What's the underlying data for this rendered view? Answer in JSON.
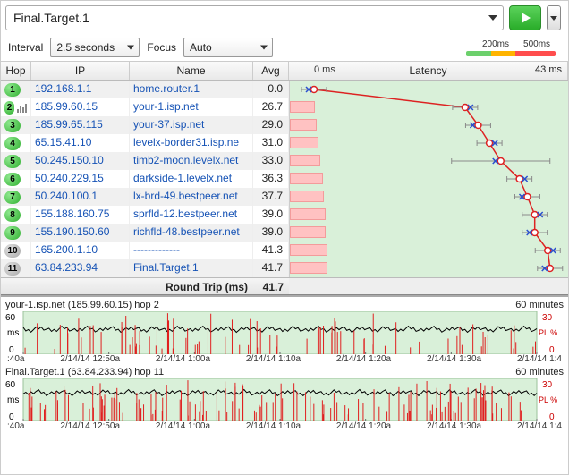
{
  "target": "Final.Target.1",
  "controls": {
    "interval_label": "Interval",
    "interval_value": "2.5 seconds",
    "focus_label": "Focus",
    "focus_value": "Auto",
    "scale_200": "200ms",
    "scale_500": "500ms"
  },
  "columns": {
    "hop": "Hop",
    "ip": "IP",
    "name": "Name",
    "avg": "Avg",
    "latency": "Latency",
    "lat_min": "0 ms",
    "lat_max": "43 ms"
  },
  "footer": {
    "label": "Round Trip (ms)",
    "value": "41.7"
  },
  "hops": [
    {
      "n": "1",
      "ip": "192.168.1.1",
      "name": "home.router.1",
      "avg": "0.0",
      "pink": 0,
      "pt": 0.0,
      "bars": false
    },
    {
      "n": "2",
      "ip": "185.99.60.15",
      "name": "your-1.isp.net",
      "avg": "26.7",
      "pink": 28,
      "pt": 26.7,
      "bars": true
    },
    {
      "n": "3",
      "ip": "185.99.65.115",
      "name": "your-37.isp.net",
      "avg": "29.0",
      "pink": 30,
      "pt": 29.0,
      "bars": false
    },
    {
      "n": "4",
      "ip": "65.15.41.10",
      "name": "levelx-border31.isp.ne",
      "avg": "31.0",
      "pink": 32,
      "pt": 31.0,
      "bars": false
    },
    {
      "n": "5",
      "ip": "50.245.150.10",
      "name": "timb2-moon.levelx.net",
      "avg": "33.0",
      "pink": 34,
      "pt": 33.0,
      "bars": false
    },
    {
      "n": "6",
      "ip": "50.240.229.15",
      "name": "darkside-1.levelx.net",
      "avg": "36.3",
      "pink": 37,
      "pt": 36.3,
      "bars": false
    },
    {
      "n": "7",
      "ip": "50.240.100.1",
      "name": "lx-brd-49.bestpeer.net",
      "avg": "37.7",
      "pink": 38,
      "pt": 37.7,
      "bars": false
    },
    {
      "n": "8",
      "ip": "155.188.160.75",
      "name": "sprfld-12.bestpeer.net",
      "avg": "39.0",
      "pink": 40,
      "pt": 39.0,
      "bars": false
    },
    {
      "n": "9",
      "ip": "155.190.150.60",
      "name": "richfld-48.bestpeer.net",
      "avg": "39.0",
      "pink": 40,
      "pt": 39.0,
      "bars": false
    },
    {
      "n": "10",
      "ip": "165.200.1.10",
      "name": "-------------",
      "avg": "41.3",
      "pink": 42,
      "pt": 41.3,
      "bars": false,
      "gray": true
    },
    {
      "n": "11",
      "ip": "63.84.233.94",
      "name": "Final.Target.1",
      "avg": "41.7",
      "pink": 42,
      "pt": 41.7,
      "bars": false,
      "gray": true
    }
  ],
  "history": [
    {
      "title": "your-1.isp.net (185.99.60.15) hop 2",
      "range": "60 minutes",
      "ymax": "60",
      "yunit": "ms",
      "pl_max": "30",
      "pl_unit": "PL %",
      "ticks": [
        ":40a",
        "2/14/14 12:50a",
        "2/14/14 1:00a",
        "2/14/14 1:10a",
        "2/14/14 1:20a",
        "2/14/14 1:30a",
        "2/14/14 1:4"
      ]
    },
    {
      "title": "Final.Target.1 (63.84.233.94) hop 11",
      "range": "60 minutes",
      "ymax": "60",
      "yunit": "ms",
      "pl_max": "30",
      "pl_unit": "PL %",
      "ticks": [
        ":40a",
        "2/14/14 12:50a",
        "2/14/14 1:00a",
        "2/14/14 1:10a",
        "2/14/14 1:20a",
        "2/14/14 1:30a",
        "2/14/14 1:4"
      ]
    }
  ],
  "chart_data": {
    "type": "line",
    "title": "Latency",
    "xlabel": "Hop",
    "ylabel": "ms",
    "ylim": [
      0,
      43
    ],
    "x": [
      1,
      2,
      3,
      4,
      5,
      6,
      7,
      8,
      9,
      10,
      11
    ],
    "values": [
      0.0,
      26.7,
      29.0,
      31.0,
      33.0,
      36.3,
      37.7,
      39.0,
      39.0,
      41.3,
      41.7
    ]
  }
}
